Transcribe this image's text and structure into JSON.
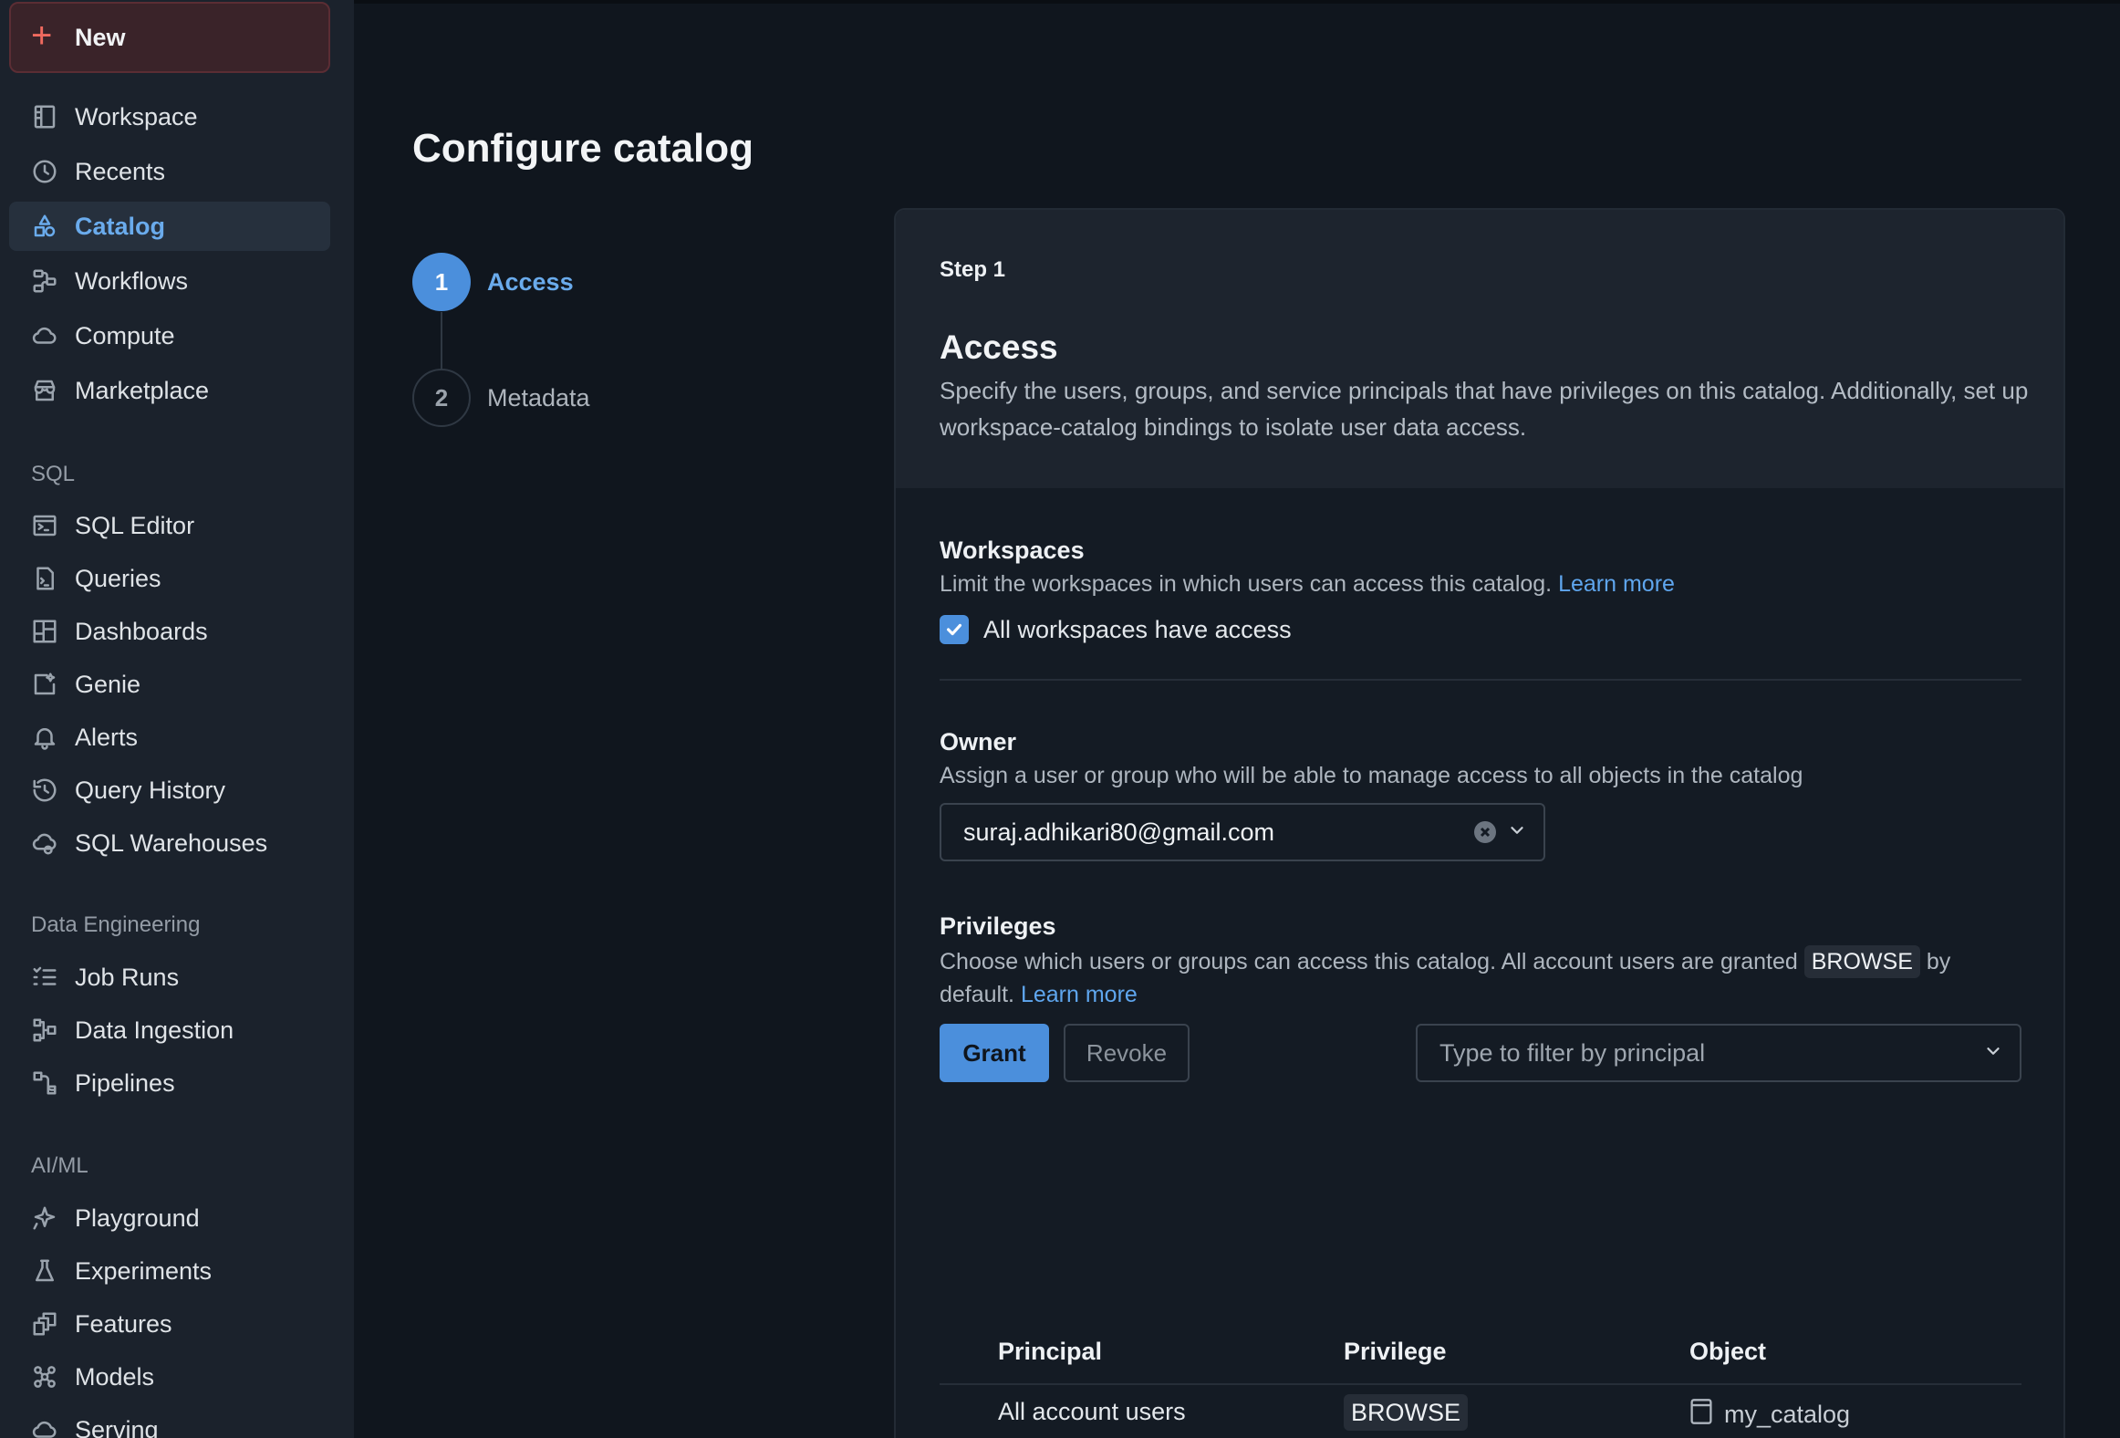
{
  "sidebar": {
    "new_label": "New",
    "top_items": [
      {
        "label": "Workspace",
        "icon": "workspace-icon"
      },
      {
        "label": "Recents",
        "icon": "clock-icon"
      },
      {
        "label": "Catalog",
        "icon": "catalog-icon",
        "active": true
      },
      {
        "label": "Workflows",
        "icon": "workflows-icon"
      },
      {
        "label": "Compute",
        "icon": "cloud-icon"
      },
      {
        "label": "Marketplace",
        "icon": "store-icon"
      }
    ],
    "sql_section": "SQL",
    "sql_items": [
      {
        "label": "SQL Editor"
      },
      {
        "label": "Queries"
      },
      {
        "label": "Dashboards"
      },
      {
        "label": "Genie"
      },
      {
        "label": "Alerts"
      },
      {
        "label": "Query History"
      },
      {
        "label": "SQL Warehouses"
      }
    ],
    "de_section": "Data Engineering",
    "de_items": [
      {
        "label": "Job Runs"
      },
      {
        "label": "Data Ingestion"
      },
      {
        "label": "Pipelines"
      }
    ],
    "ml_section": "AI/ML",
    "ml_items": [
      {
        "label": "Playground"
      },
      {
        "label": "Experiments"
      },
      {
        "label": "Features"
      },
      {
        "label": "Models"
      },
      {
        "label": "Serving"
      }
    ]
  },
  "page": {
    "title": "Configure catalog",
    "steps": [
      {
        "number": "1",
        "label": "Access"
      },
      {
        "number": "2",
        "label": "Metadata"
      }
    ]
  },
  "card": {
    "kicker": "Step 1",
    "title": "Access",
    "description": "Specify the users, groups, and service principals that have privileges on this catalog. Additionally, set up workspace-catalog bindings to isolate user data access.",
    "workspaces": {
      "title": "Workspaces",
      "description": "Limit the workspaces in which users can access this catalog.",
      "learn_more": "Learn more",
      "checkbox_label": "All workspaces have access",
      "checked": true
    },
    "owner": {
      "title": "Owner",
      "description": "Assign a user or group who will be able to manage access to all objects in the catalog",
      "value": "suraj.adhikari80@gmail.com"
    },
    "privileges": {
      "title": "Privileges",
      "desc_before": "Choose which users or groups can access this catalog. All account users are granted",
      "desc_code": "BROWSE",
      "desc_after_1": "by",
      "desc_after_2": "default.",
      "learn_more": "Learn more",
      "grant_label": "Grant",
      "revoke_label": "Revoke",
      "filter_placeholder": "Type to filter by principal",
      "table": {
        "headers": [
          "Principal",
          "Privilege",
          "Object"
        ],
        "rows": [
          {
            "principal": "All account users",
            "privilege": "BROWSE",
            "object": "my_catalog"
          }
        ]
      }
    }
  },
  "colors": {
    "accent": "#4b8fdc",
    "link": "#5fa6ee",
    "new_button": "#f06a5f"
  }
}
